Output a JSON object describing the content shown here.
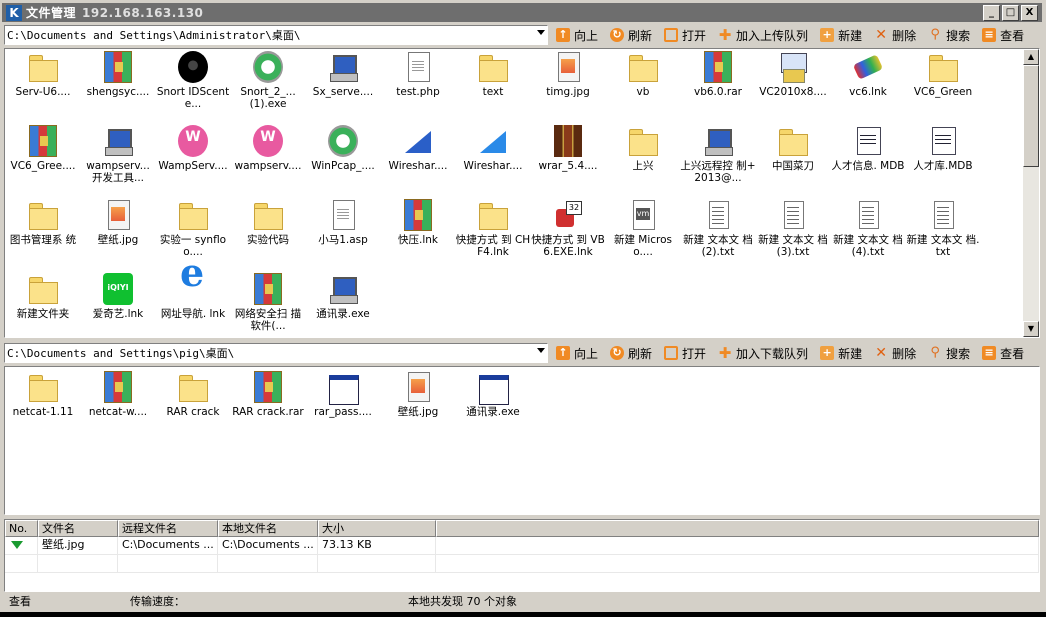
{
  "window": {
    "title": "文件管理",
    "address": "192.168.163.130",
    "controls": {
      "minimize": "_",
      "maximize": "□",
      "close": "X"
    }
  },
  "remote": {
    "path": "C:\\Documents and Settings\\Administrator\\桌面\\",
    "toolbar": [
      "向上",
      "刷新",
      "打开",
      "加入上传队列",
      "新建",
      "删除",
      "搜索",
      "查看"
    ],
    "items": [
      {
        "label": "Serv-U6....",
        "icon": "folder"
      },
      {
        "label": "shengsyc....",
        "icon": "rar"
      },
      {
        "label": "Snort IDScente...",
        "icon": "round-black"
      },
      {
        "label": "Snort_2_... (1).exe",
        "icon": "winpcap"
      },
      {
        "label": "Sx_serve....",
        "icon": "pc"
      },
      {
        "label": "test.php",
        "icon": "doc"
      },
      {
        "label": "text",
        "icon": "folder"
      },
      {
        "label": "timg.jpg",
        "icon": "img"
      },
      {
        "label": "vb",
        "icon": "folder"
      },
      {
        "label": "vb6.0.rar",
        "icon": "rar"
      },
      {
        "label": "VC2010x8....",
        "icon": "vcproj"
      },
      {
        "label": "vc6.lnk",
        "icon": "vc6"
      },
      {
        "label": "VC6_Green",
        "icon": "folder"
      },
      {
        "label": "VC6_Gree....",
        "icon": "rar"
      },
      {
        "label": "wampserv... 开发工具...",
        "icon": "pc"
      },
      {
        "label": "WampServ....",
        "icon": "pink"
      },
      {
        "label": "wampserv....",
        "icon": "pink"
      },
      {
        "label": "WinPcap_....",
        "icon": "winpcap"
      },
      {
        "label": "Wireshar....",
        "icon": "shark"
      },
      {
        "label": "Wireshar....",
        "icon": "shark2"
      },
      {
        "label": "wrar_5.4....",
        "icon": "books"
      },
      {
        "label": "上兴",
        "icon": "folder"
      },
      {
        "label": "上兴远程控 制+2013@...",
        "icon": "pc"
      },
      {
        "label": "中国菜刀",
        "icon": "folder"
      },
      {
        "label": "人才信息. MDB",
        "icon": "mdb"
      },
      {
        "label": "人才库.MDB",
        "icon": "mdb"
      },
      {
        "label": "图书管理系 统",
        "icon": "folder"
      },
      {
        "label": "壁纸.jpg",
        "icon": "img"
      },
      {
        "label": "实验一 synfloo....",
        "icon": "folder"
      },
      {
        "label": "实验代码",
        "icon": "folder"
      },
      {
        "label": "小马1.asp",
        "icon": "doc"
      },
      {
        "label": "快压.lnk",
        "icon": "rar"
      },
      {
        "label": "快捷方式 到 CHF4.lnk",
        "icon": "folder"
      },
      {
        "label": "快捷方式 到 VB6.EXE.lnk",
        "icon": "shortcut"
      },
      {
        "label": "新建 Microso....",
        "icon": "vm"
      },
      {
        "label": "新建 文本文 档 (2).txt",
        "icon": "txt"
      },
      {
        "label": "新建 文本文 档 (3).txt",
        "icon": "txt"
      },
      {
        "label": "新建 文本文 档 (4).txt",
        "icon": "txt"
      },
      {
        "label": "新建 文本文 档.txt",
        "icon": "txt"
      },
      {
        "label": "新建文件夹",
        "icon": "folder"
      },
      {
        "label": "爱奇艺.lnk",
        "icon": "iqiyi"
      },
      {
        "label": "网址导航. lnk",
        "icon": "ie"
      },
      {
        "label": "网络安全扫 描软件(...",
        "icon": "rar"
      },
      {
        "label": "通讯录.exe",
        "icon": "pc"
      }
    ]
  },
  "local": {
    "path": "C:\\Documents and Settings\\pig\\桌面\\",
    "toolbar": [
      "向上",
      "刷新",
      "打开",
      "加入下载队列",
      "新建",
      "删除",
      "搜索",
      "查看"
    ],
    "items": [
      {
        "label": "netcat-1.11",
        "icon": "folder"
      },
      {
        "label": "netcat-w....",
        "icon": "rar"
      },
      {
        "label": "RAR crack",
        "icon": "folder"
      },
      {
        "label": "RAR crack.rar",
        "icon": "rar"
      },
      {
        "label": "rar_pass....",
        "icon": "win"
      },
      {
        "label": "壁纸.jpg",
        "icon": "img"
      },
      {
        "label": "通讯录.exe",
        "icon": "win"
      }
    ]
  },
  "transfer": {
    "columns": [
      "No.",
      "文件名",
      "远程文件名",
      "本地文件名",
      "大小"
    ],
    "rows": [
      {
        "no": "",
        "name": "壁纸.jpg",
        "remote": "C:\\Documents ...",
        "local": "C:\\Documents ...",
        "size": "73.13 KB"
      }
    ]
  },
  "status": {
    "left": "查看",
    "speed": "传输速度：",
    "count": "本地共发现 70 个对象"
  }
}
